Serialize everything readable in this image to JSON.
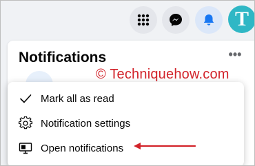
{
  "panel": {
    "title": "Notifications",
    "more_label": "•••"
  },
  "header": {
    "avatar_letter": "T",
    "icons": [
      "menu-grid-icon",
      "messenger-icon",
      "bell-icon"
    ]
  },
  "watermark": "© Techniquehow.com",
  "menu": {
    "items": [
      {
        "label": "Mark all as read",
        "icon": "check-icon"
      },
      {
        "label": "Notification settings",
        "icon": "gear-icon"
      },
      {
        "label": "Open notifications",
        "icon": "monitor-icon"
      }
    ]
  },
  "colors": {
    "accent": "#1877f2",
    "annotation": "#d2232a",
    "avatar": "#2fb7c5"
  }
}
